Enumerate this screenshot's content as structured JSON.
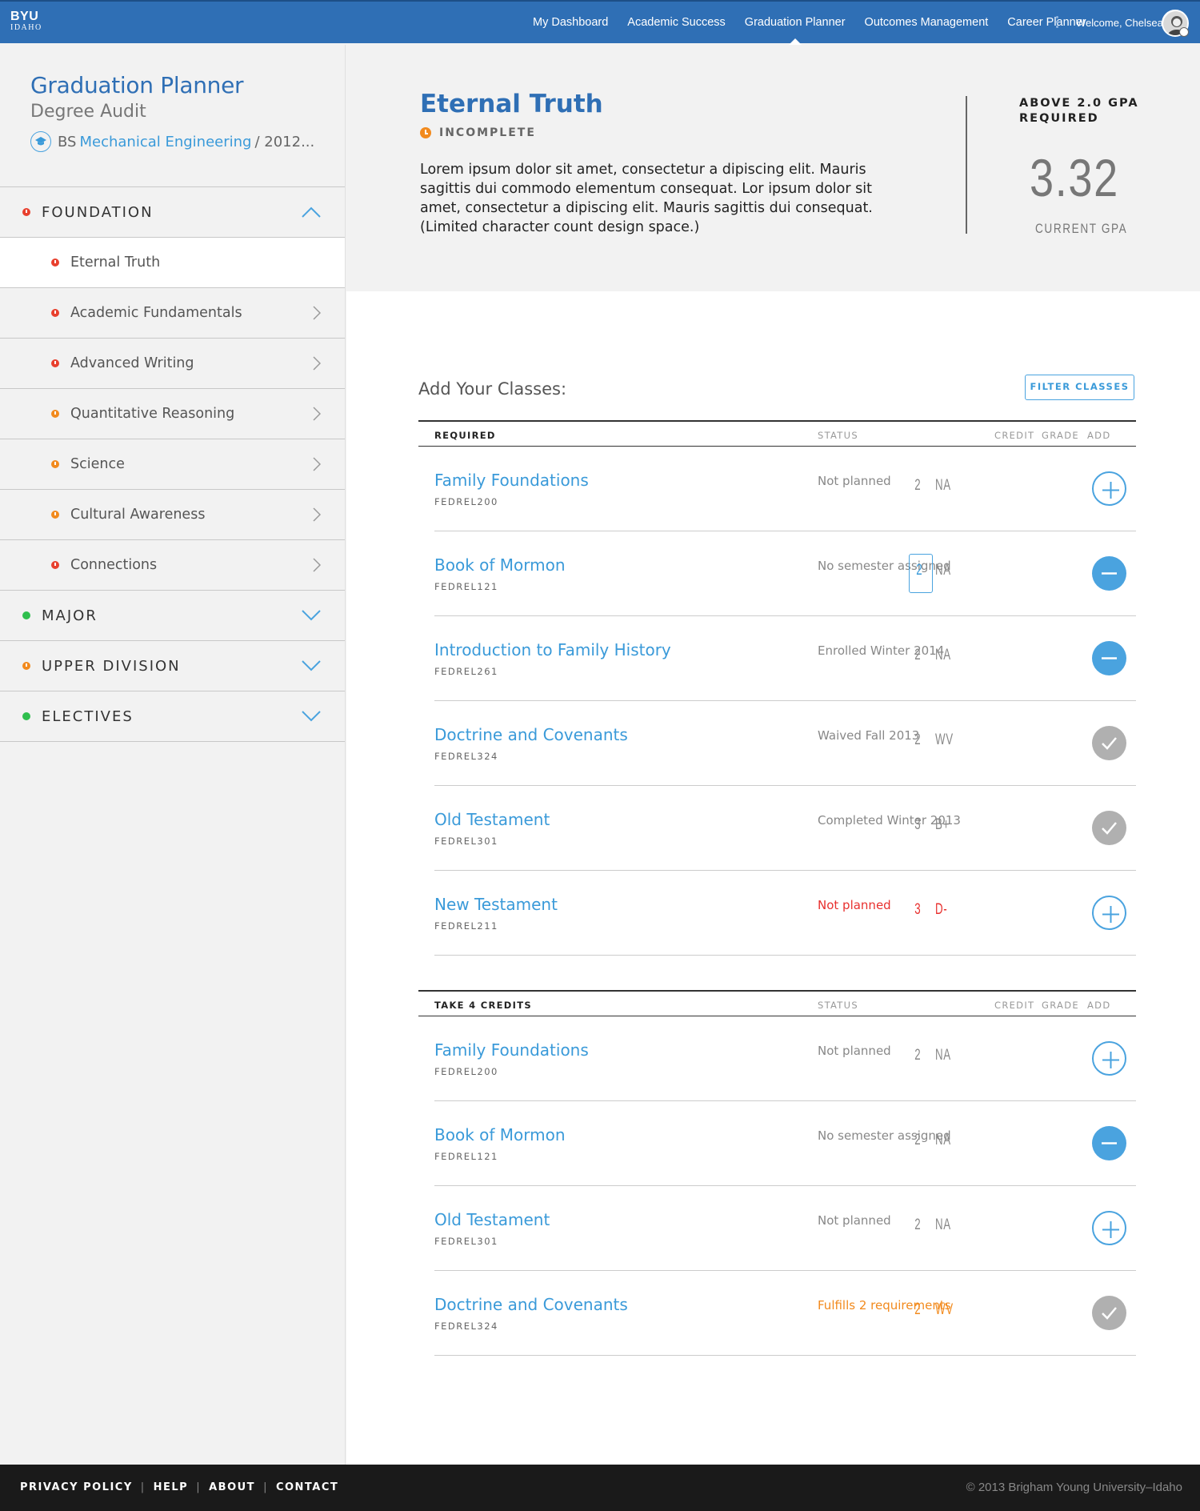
{
  "brand": {
    "name": "BYU",
    "sub": "IDAHO"
  },
  "nav": {
    "items": [
      "My Dashboard",
      "Academic Success",
      "Graduation Planner",
      "Outcomes Management",
      "Career Planner"
    ],
    "active_index": 2,
    "welcome": "Welcome, Chelsea!"
  },
  "sidebar": {
    "title": "Graduation Planner",
    "subtitle": "Degree Audit",
    "degree_prefix": "BS",
    "degree_link": "Mechanical Engineering",
    "degree_suffix": "/ 2012...",
    "sections": [
      {
        "label": "FOUNDATION",
        "status": "red",
        "expanded": true,
        "items": [
          {
            "label": "Eternal Truth",
            "status": "red",
            "selected": true
          },
          {
            "label": "Academic Fundamentals",
            "status": "red"
          },
          {
            "label": "Advanced Writing",
            "status": "red"
          },
          {
            "label": "Quantitative Reasoning",
            "status": "orange"
          },
          {
            "label": "Science",
            "status": "orange"
          },
          {
            "label": "Cultural Awareness",
            "status": "orange"
          },
          {
            "label": "Connections",
            "status": "red"
          }
        ]
      },
      {
        "label": "MAJOR",
        "status": "green",
        "expanded": false
      },
      {
        "label": "UPPER DIVISION",
        "status": "orange",
        "expanded": false
      },
      {
        "label": "ELECTIVES",
        "status": "green",
        "expanded": false
      }
    ]
  },
  "hero": {
    "title": "Eternal Truth",
    "status": "INCOMPLETE",
    "description": "Lorem ipsum dolor sit amet, consectetur a dipiscing elit. Mauris sagittis dui commodo elementum consequat. Lor ipsum dolor sit amet, consectetur a dipiscing elit. Mauris sagittis dui consequat. (Limited character count design space.)",
    "gpa_requirement_line1": "ABOVE 2.0 GPA",
    "gpa_requirement_line2": "REQUIRED",
    "gpa_value": "3.32",
    "gpa_label": "CURRENT GPA"
  },
  "classes": {
    "title": "Add Your Classes:",
    "filter_label": "FILTER CLASSES",
    "headers": {
      "status": "STATUS",
      "credit": "CREDIT",
      "grade": "GRADE",
      "add": "ADD"
    },
    "tables": [
      {
        "heading": "REQUIRED",
        "rows": [
          {
            "name": "Family Foundations",
            "code": "FEDREL200",
            "status": "Not planned",
            "status_color": "gray",
            "credit": "2",
            "grade": "NA",
            "action": "plus"
          },
          {
            "name": "Book of Mormon",
            "code": "FEDREL121",
            "status": "No semester assigned",
            "status_color": "gray",
            "credit": "2",
            "grade": "NA",
            "action": "minus",
            "credit_boxed": true
          },
          {
            "name": "Introduction to Family History",
            "code": "FEDREL261",
            "status": "Enrolled Winter 2014",
            "status_color": "gray",
            "credit": "2",
            "grade": "NA",
            "action": "minus"
          },
          {
            "name": "Doctrine and Covenants",
            "code": "FEDREL324",
            "status": "Waived Fall 2013",
            "status_color": "gray",
            "credit": "2",
            "grade": "WV",
            "action": "check"
          },
          {
            "name": "Old Testament",
            "code": "FEDREL301",
            "status": "Completed Winter 2013",
            "status_color": "gray",
            "credit": "3",
            "grade": "B+",
            "action": "check"
          },
          {
            "name": "New Testament",
            "code": "FEDREL211",
            "status": "Not planned",
            "status_color": "red",
            "credit": "3",
            "grade": "D-",
            "action": "plus"
          }
        ]
      },
      {
        "heading": "TAKE 4 CREDITS",
        "rows": [
          {
            "name": "Family Foundations",
            "code": "FEDREL200",
            "status": "Not planned",
            "status_color": "gray",
            "credit": "2",
            "grade": "NA",
            "action": "plus"
          },
          {
            "name": "Book of Mormon",
            "code": "FEDREL121",
            "status": "No semester assigned",
            "status_color": "gray",
            "credit": "2",
            "grade": "NA",
            "action": "minus"
          },
          {
            "name": "Old Testament",
            "code": "FEDREL301",
            "status": "Not planned",
            "status_color": "gray",
            "credit": "2",
            "grade": "NA",
            "action": "plus"
          },
          {
            "name": "Doctrine and Covenants",
            "code": "FEDREL324",
            "status": "Fulfills 2 requirements",
            "status_color": "orange",
            "credit": "2",
            "grade": "WV",
            "action": "check"
          }
        ]
      }
    ]
  },
  "footer": {
    "links": [
      "PRIVACY POLICY",
      "HELP",
      "ABOUT",
      "CONTACT"
    ],
    "copyright": "© 2013 Brigham Young University–Idaho"
  },
  "colors": {
    "brand_blue": "#2f6fb5",
    "accent_blue": "#4aa3df",
    "red": "#e8402e",
    "orange": "#f28a1d",
    "green": "#2fbf4e"
  }
}
